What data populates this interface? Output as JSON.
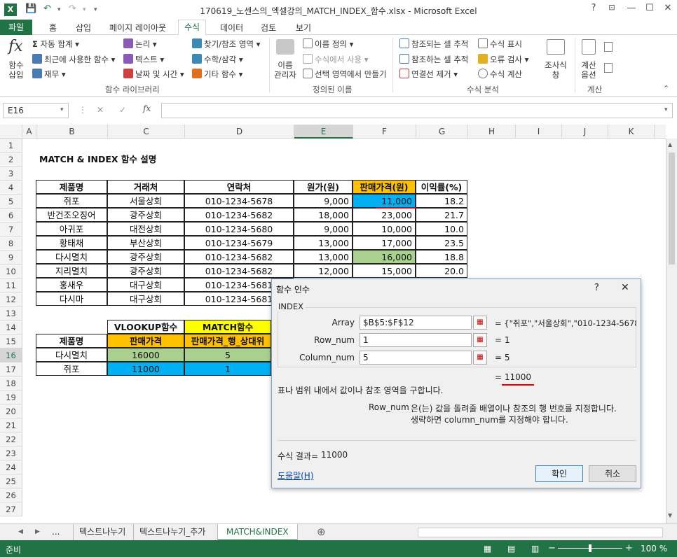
{
  "title": "170619_노센스의_엑셀강의_MATCH_INDEX_함수.xlsx - Microsoft Excel",
  "window": {
    "help": "?",
    "restore": "⊡",
    "min": "—",
    "max": "☐",
    "close": "✕"
  },
  "tabs": [
    "파일",
    "홈",
    "삽입",
    "페이지 레이아웃",
    "수식",
    "데이터",
    "검토",
    "보기"
  ],
  "ribbon": {
    "insert_fn": [
      "함수",
      "삽입"
    ],
    "autosum": "자동 합계",
    "recent": "최근에 사용한 함수",
    "finance": "재무",
    "logic": "논리",
    "text": "텍스트",
    "datetime": "날짜 및 시간",
    "lookup": "찾기/참조 영역",
    "math": "수학/삼각",
    "other": "기타 함수",
    "name_mgr": [
      "이름",
      "관리자"
    ],
    "define_name": "이름 정의",
    "use_in_formula": "수식에서 사용",
    "create_sel": "선택 영역에서 만들기",
    "trace_prec": "참조되는 셀 추적",
    "trace_dep": "참조하는 셀 추적",
    "remove_arrows": "연결선 제거",
    "show_formulas": "수식 표시",
    "error_check": "오류 검사",
    "eval_formula": "수식 계산",
    "watch": [
      "조사식",
      "창"
    ],
    "calc_opts": [
      "계산",
      "옵션"
    ],
    "groups": [
      "함수 라이브러리",
      "정의된 이름",
      "수식 분석",
      "계산"
    ]
  },
  "namebox": "E16",
  "columns": [
    "A",
    "B",
    "C",
    "D",
    "E",
    "F",
    "G",
    "H",
    "I",
    "J",
    "K"
  ],
  "rows": [
    "1",
    "2",
    "3",
    "4",
    "5",
    "6",
    "7",
    "8",
    "9",
    "10",
    "11",
    "12",
    "13",
    "14",
    "15",
    "16",
    "17",
    "18",
    "19",
    "20",
    "21",
    "22",
    "23",
    "24",
    "25",
    "26",
    "27"
  ],
  "sheet_title": "MATCH & INDEX 함수 설명",
  "table_headers": [
    "제품명",
    "거래처",
    "연락처",
    "원가(원)",
    "판매가격(원)",
    "이익률(%)"
  ],
  "table_rows": [
    [
      "쥐포",
      "서울상회",
      "010-1234-5678",
      "9,000",
      "11,000",
      "18.2"
    ],
    [
      "반건조오징어",
      "광주상회",
      "010-1234-5682",
      "18,000",
      "23,000",
      "21.7"
    ],
    [
      "아귀포",
      "대전상회",
      "010-1234-5680",
      "9,000",
      "10,000",
      "10.0"
    ],
    [
      "황태채",
      "부산상회",
      "010-1234-5679",
      "13,000",
      "17,000",
      "23.5"
    ],
    [
      "다시멸치",
      "광주상회",
      "010-1234-5682",
      "13,000",
      "16,000",
      "18.8"
    ],
    [
      "지리멸치",
      "광주상회",
      "010-1234-5682",
      "12,000",
      "15,000",
      "20.0"
    ],
    [
      "홍새우",
      "대구상회",
      "010-1234-5681",
      "",
      "",
      " "
    ],
    [
      "다시마",
      "대구상회",
      "010-1234-5681",
      "",
      "",
      " "
    ]
  ],
  "lower": {
    "vlookup": "VLOOKUP함수",
    "match": "MATCH함수",
    "h_name": "제품명",
    "h_price": "판매가격",
    "h_match": "판매가격_행_상대위",
    "rows": [
      [
        "다시멸치",
        "16000",
        "5"
      ],
      [
        "쥐포",
        "11000",
        "1"
      ]
    ]
  },
  "dialog": {
    "title": "함수 인수",
    "help": "?",
    "close": "✕",
    "fn": "INDEX",
    "args": [
      {
        "label": "Array",
        "value": "$B$5:$F$12",
        "result": "= {\"쥐포\",\"서울상회\",\"010-1234-5678\""
      },
      {
        "label": "Row_num",
        "value": "1",
        "result": "= 1"
      },
      {
        "label": "Column_num",
        "value": "5",
        "result": "= 5"
      }
    ],
    "total": "= 11000",
    "desc": "표나 범위 내에서 값이나 참조 영역을 구합니다.",
    "arg_name": "Row_num",
    "arg_desc1": "은(는) 값을 돌려줄 배열이나 참조의 행 번호를 지정합니다.",
    "arg_desc2": "생략하면 column_num를 지정해야 합니다.",
    "result_label": "수식 결과=",
    "result_value": "11000",
    "help_link": "도움말(H)",
    "ok": "확인",
    "cancel": "취소"
  },
  "sheet_tabs": [
    "...",
    "텍스트나누기",
    "텍스트나누기_추가",
    "MATCH&INDEX"
  ],
  "status": {
    "ready": "준비",
    "zoom": "100 %",
    "minus": "−",
    "plus": "+"
  },
  "colors": {
    "accent": "#217346",
    "orange": "#ffc000",
    "blue": "#00b0f0",
    "green": "#a9d08e",
    "yellow": "#ffff00"
  }
}
